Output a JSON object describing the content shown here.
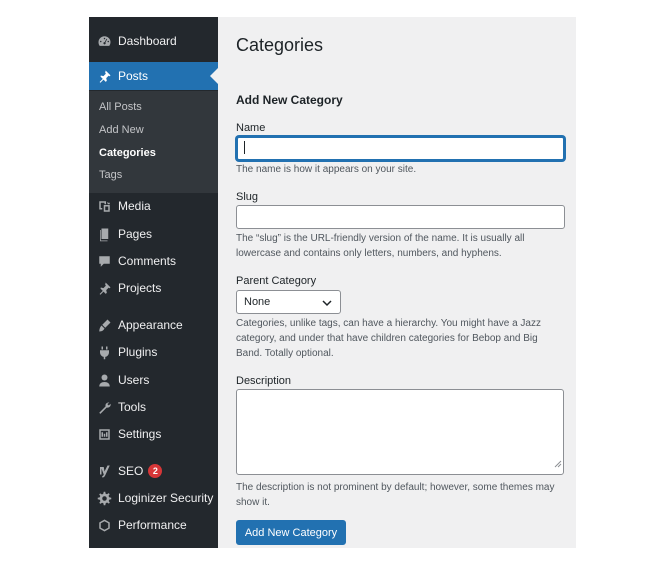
{
  "sidebar": {
    "items": [
      {
        "key": "dashboard",
        "label": "Dashboard",
        "icon": "dashboard-icon"
      },
      {
        "key": "posts",
        "label": "Posts",
        "icon": "pin-icon",
        "active": true
      },
      {
        "key": "media",
        "label": "Media",
        "icon": "media-icon"
      },
      {
        "key": "pages",
        "label": "Pages",
        "icon": "pages-icon"
      },
      {
        "key": "comments",
        "label": "Comments",
        "icon": "comment-icon"
      },
      {
        "key": "projects",
        "label": "Projects",
        "icon": "pin-icon"
      },
      {
        "key": "appearance",
        "label": "Appearance",
        "icon": "brush-icon"
      },
      {
        "key": "plugins",
        "label": "Plugins",
        "icon": "plugin-icon"
      },
      {
        "key": "users",
        "label": "Users",
        "icon": "user-icon"
      },
      {
        "key": "tools",
        "label": "Tools",
        "icon": "wrench-icon"
      },
      {
        "key": "settings",
        "label": "Settings",
        "icon": "settings-icon"
      },
      {
        "key": "seo",
        "label": "SEO",
        "icon": "yoast-icon",
        "badge": "2"
      },
      {
        "key": "loginizer",
        "label": "Loginizer Security",
        "icon": "gear-icon"
      },
      {
        "key": "performance",
        "label": "Performance",
        "icon": "performance-icon"
      }
    ],
    "submenu": [
      {
        "label": "All Posts"
      },
      {
        "label": "Add New"
      },
      {
        "label": "Categories",
        "current": true
      },
      {
        "label": "Tags"
      }
    ]
  },
  "main": {
    "title": "Categories",
    "form_heading": "Add New Category",
    "name": {
      "label": "Name",
      "value": "",
      "help": "The name is how it appears on your site."
    },
    "slug": {
      "label": "Slug",
      "value": "",
      "help": "The “slug” is the URL-friendly version of the name. It is usually all lowercase and contains only letters, numbers, and hyphens."
    },
    "parent": {
      "label": "Parent Category",
      "selected": "None",
      "help": "Categories, unlike tags, can have a hierarchy. You might have a Jazz category, and under that have children categories for Bebop and Big Band. Totally optional."
    },
    "description": {
      "label": "Description",
      "value": "",
      "help": "The description is not prominent by default; however, some themes may show it."
    },
    "submit_label": "Add New Category"
  },
  "colors": {
    "sidebar_bg": "#23282d",
    "submenu_bg": "#32373c",
    "accent": "#2271b1",
    "main_bg": "#f0f0f1",
    "badge": "#d63638"
  }
}
